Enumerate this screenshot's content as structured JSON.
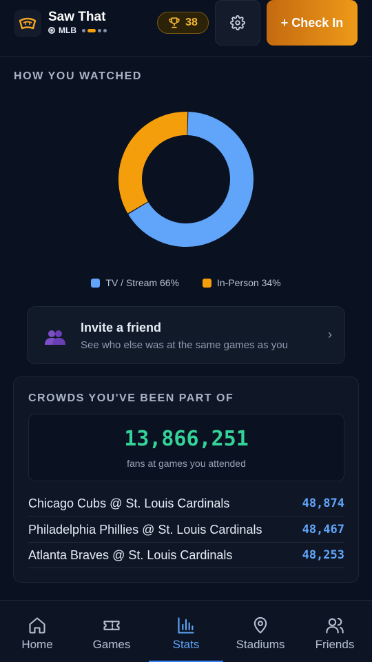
{
  "header": {
    "app_title": "Saw That",
    "league": "MLB",
    "trophy_count": "38",
    "checkin_label": "+ Check In",
    "icons": {
      "logo": "stadium-logo-icon",
      "trophy": "trophy-icon",
      "settings": "gear-icon"
    }
  },
  "watch": {
    "heading": "HOW YOU WATCHED",
    "legend": [
      {
        "label": "TV / Stream 66%",
        "color": "#60a5fa"
      },
      {
        "label": "In-Person 34%",
        "color": "#f59e0b"
      }
    ]
  },
  "chart_data": {
    "type": "pie",
    "style": "donut",
    "categories": [
      "TV / Stream",
      "In-Person"
    ],
    "values": [
      66,
      34
    ],
    "colors": [
      "#60a5fa",
      "#f59e0b"
    ],
    "title": ""
  },
  "invite": {
    "title": "Invite a friend",
    "subtitle": "See who else was at the same games as you",
    "chevron": "›",
    "icon": "two-people-icon"
  },
  "crowds": {
    "heading": "CROWDS YOU'VE BEEN PART OF",
    "total": "13,866,251",
    "total_caption": "fans at games you attended",
    "games": [
      {
        "matchup": "Chicago Cubs @ St. Louis Cardinals",
        "attendance": "48,874"
      },
      {
        "matchup": "Philadelphia Phillies @ St. Louis Cardinals",
        "attendance": "48,467"
      },
      {
        "matchup": "Atlanta Braves @ St. Louis Cardinals",
        "attendance": "48,253"
      }
    ]
  },
  "nav": {
    "items": [
      {
        "label": "Home",
        "icon": "home-icon"
      },
      {
        "label": "Games",
        "icon": "ticket-icon"
      },
      {
        "label": "Stats",
        "icon": "bar-chart-icon",
        "active": true
      },
      {
        "label": "Stadiums",
        "icon": "map-pin-icon"
      },
      {
        "label": "Friends",
        "icon": "users-icon"
      }
    ]
  }
}
